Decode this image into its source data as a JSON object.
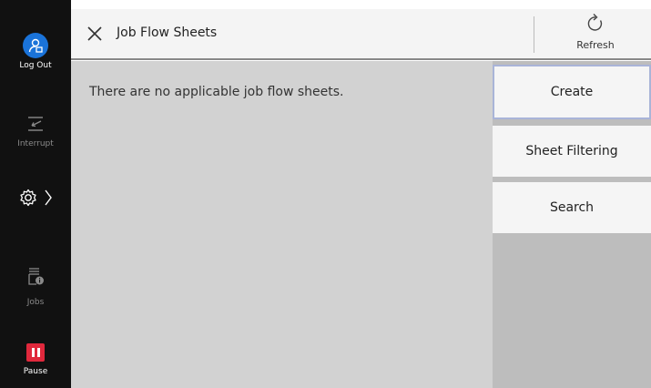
{
  "header": {
    "title": "Job Flow Sheets",
    "refresh_label": "Refresh"
  },
  "rail": {
    "logout_label": "Log Out",
    "interrupt_label": "Interrupt",
    "jobs_label": "Jobs",
    "pause_label": "Pause"
  },
  "content": {
    "empty_message": "There are no applicable job flow sheets."
  },
  "side_buttons": {
    "create": "Create",
    "sheet_filtering": "Sheet Filtering",
    "search": "Search"
  },
  "colors": {
    "rail_bg": "#111111",
    "logout_accent": "#1a73d9",
    "pause_accent": "#e0283c",
    "content_bg": "#d2d2d2",
    "focus_border": "#a9b4d8"
  },
  "icons": [
    "user-icon",
    "interrupt-icon",
    "gear-icon",
    "chevron-right-icon",
    "jobs-icon",
    "pause-icon",
    "close-icon",
    "refresh-icon"
  ]
}
